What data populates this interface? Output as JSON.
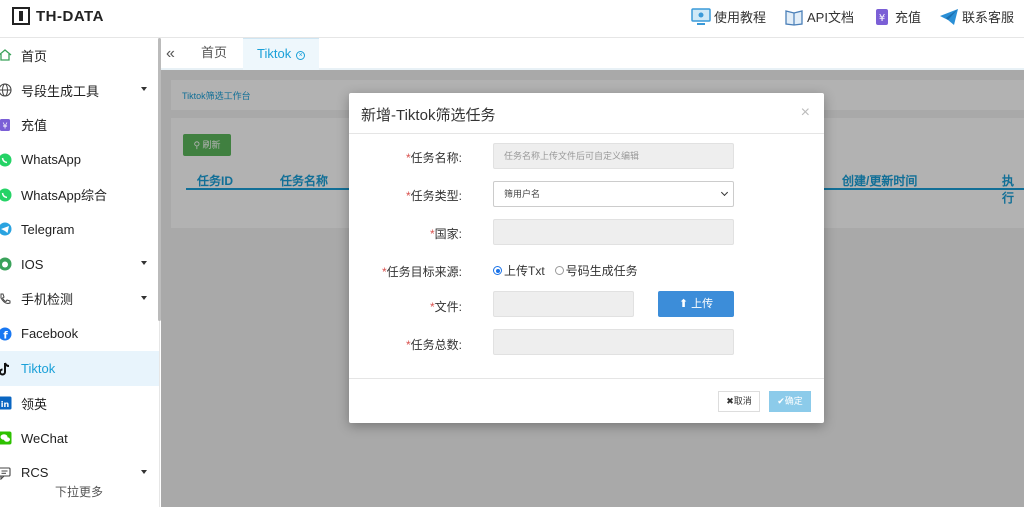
{
  "brand": {
    "name": "TH-DATA"
  },
  "topnav": [
    {
      "label": "使用教程",
      "icon": "monitor-icon"
    },
    {
      "label": "API文档",
      "icon": "book-icon"
    },
    {
      "label": "充值",
      "icon": "yen-icon"
    },
    {
      "label": "联系客服",
      "icon": "paper-plane-icon"
    }
  ],
  "sidebar": {
    "items": [
      {
        "label": "首页",
        "icon": "home-icon",
        "caret": false
      },
      {
        "label": "号段生成工具",
        "icon": "globe-icon",
        "caret": true
      },
      {
        "label": "充值",
        "icon": "yen-icon",
        "caret": false
      },
      {
        "label": "WhatsApp",
        "icon": "whatsapp-icon",
        "caret": false
      },
      {
        "label": "WhatsApp综合",
        "icon": "whatsapp-icon",
        "caret": false
      },
      {
        "label": "Telegram",
        "icon": "telegram-icon",
        "caret": false
      },
      {
        "label": "IOS",
        "icon": "apple-icon",
        "caret": true
      },
      {
        "label": "手机检测",
        "icon": "phone-icon",
        "caret": true
      },
      {
        "label": "Facebook",
        "icon": "facebook-icon",
        "caret": false
      },
      {
        "label": "Tiktok",
        "icon": "tiktok-icon",
        "caret": false,
        "active": true
      },
      {
        "label": "领英",
        "icon": "linkedin-icon",
        "caret": false
      },
      {
        "label": "WeChat",
        "icon": "wechat-icon",
        "caret": false
      },
      {
        "label": "RCS",
        "icon": "chat-icon",
        "caret": true
      }
    ],
    "more": "下拉更多"
  },
  "tabs": {
    "home": "首页",
    "tiktok": "Tiktok"
  },
  "page": {
    "breadcrumb": "Tiktok筛选工作台",
    "refresh": "刷新",
    "columns": [
      "任务ID",
      "任务名称",
      "创建/更新时间",
      "执行"
    ]
  },
  "modal": {
    "title": "新增-Tiktok筛选任务",
    "close": "×",
    "fields": {
      "name_label": "任务名称:",
      "name_placeholder": "任务名称上传文件后可自定义编辑",
      "type_label": "任务类型:",
      "type_value": "筛用户名",
      "country_label": "国家:",
      "source_label": "任务目标来源:",
      "source_opt1": "上传Txt",
      "source_opt2": "号码生成任务",
      "file_label": "文件:",
      "upload": "上传",
      "total_label": "任务总数:"
    },
    "cancel": "取消",
    "ok": "确定"
  },
  "colors": {
    "accent": "#1aa0d8",
    "success": "#5cb85c",
    "primary": "#3c8dd9",
    "required": "#d9534f"
  }
}
